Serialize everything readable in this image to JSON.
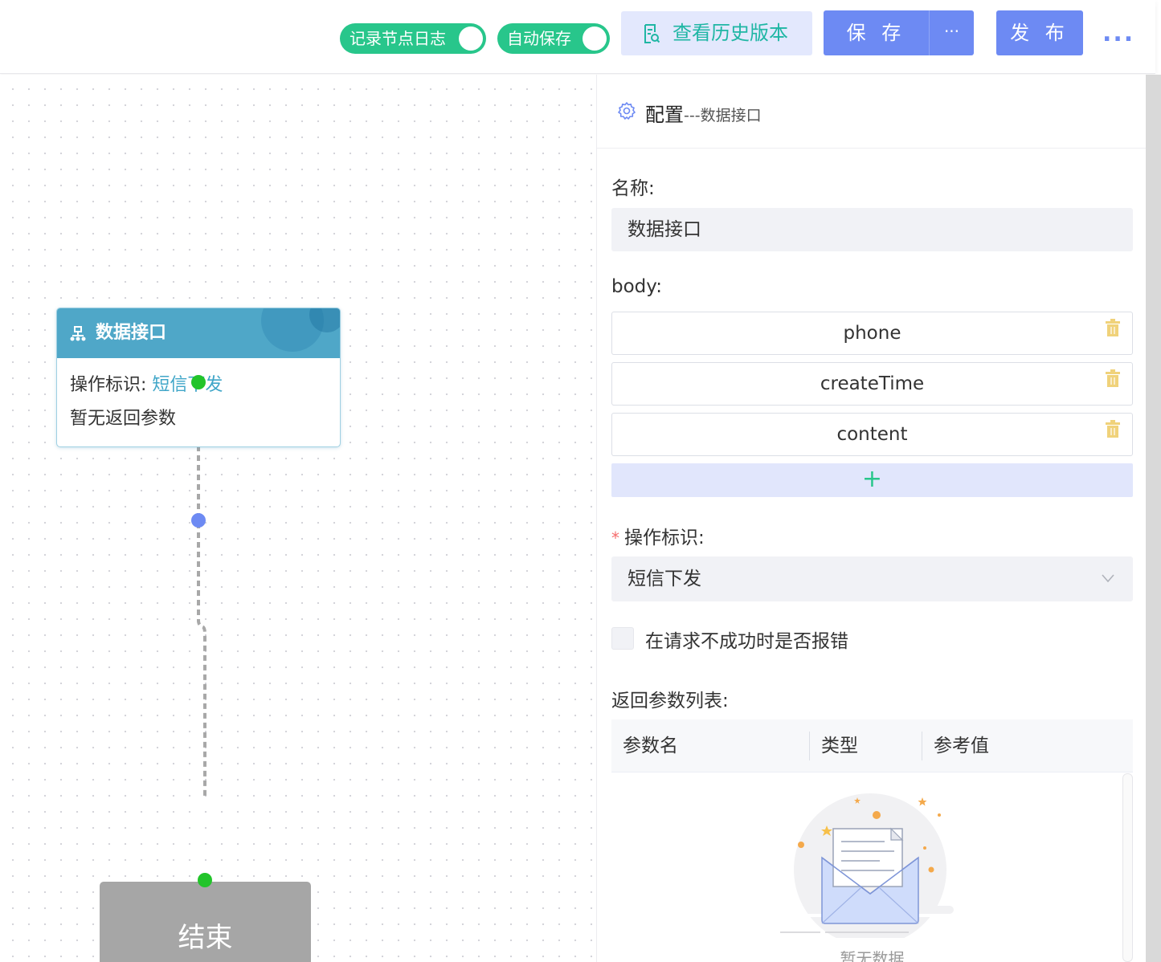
{
  "toolbar": {
    "toggle_log_label": "记录节点日志",
    "toggle_log_on": true,
    "toggle_autosave_label": "自动保存",
    "toggle_autosave_on": true,
    "history_label": "查看历史版本",
    "save_label": "保 存",
    "save_more_label": "···",
    "publish_label": "发 布",
    "more_label": "..."
  },
  "canvas": {
    "node": {
      "title": "数据接口",
      "op_label": "操作标识: ",
      "op_value": "短信下发",
      "return_text": "暂无返回参数"
    },
    "end_node": {
      "label": "结束"
    }
  },
  "panel": {
    "title": "配置",
    "subtitle": "---数据接口",
    "name_label": "名称:",
    "name_value": "数据接口",
    "body_label": "body:",
    "body_items": [
      "phone",
      "createTime",
      "content"
    ],
    "add_label": "+",
    "op_label": "操作标识:",
    "required_mark": "*",
    "op_value": "短信下发",
    "checkbox_label": "在请求不成功时是否报错",
    "checkbox_checked": false,
    "return_label": "返回参数列表:",
    "table_columns": [
      "参数名",
      "类型",
      "参考值"
    ],
    "empty_text": "暂无数据"
  },
  "colors": {
    "primary": "#6d8af3",
    "toggle_on": "#28c68b",
    "node_header": "#4fa7c8",
    "end_node": "#a6a6a6",
    "port_green": "#22c42a",
    "trash": "#f0d27a"
  }
}
